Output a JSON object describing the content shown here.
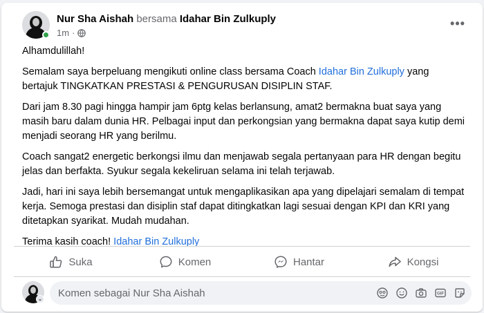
{
  "post": {
    "author": "Nur Sha Aishah",
    "with_text": "bersama",
    "tagged": "Idahar Bin Zulkuply",
    "time": "1m",
    "time_sep": "·",
    "privacy_icon": "globe-icon",
    "more_icon": "more-options-icon",
    "more_label": "•••"
  },
  "content": {
    "p1": "Alhamdulillah!",
    "p2_before": "Semalam saya berpeluang mengikuti online class bersama Coach ",
    "p2_link": "Idahar Bin Zulkuply",
    "p2_after": " yang bertajuk TINGKATKAN PRESTASI & PENGURUSAN DISIPLIN STAF.",
    "p3": "Dari jam 8.30 pagi hingga hampir jam 6ptg kelas berlansung, amat2 bermakna buat saya yang masih baru dalam dunia HR. Pelbagai input dan perkongsian yang bermakna dapat saya kutip demi menjadi seorang HR yang berilmu.",
    "p4": "Coach sangat2 energetic berkongsi ilmu dan menjawab segala pertanyaan para HR dengan begitu jelas dan berfakta. Syukur segala kekeliruan selama ini telah terjawab.",
    "p5": "Jadi, hari ini saya lebih bersemangat untuk mengaplikasikan apa yang dipelajari semalam di tempat kerja. Semoga prestasi dan disiplin staf dapat ditingkatkan lagi sesuai dengan KPI dan KRI yang ditetapkan syarikat. Mudah mudahan.",
    "p6_before": "Terima kasih coach! ",
    "p6_link": "Idahar Bin Zulkuply"
  },
  "actions": {
    "like": "Suka",
    "comment": "Komen",
    "send": "Hantar",
    "share": "Kongsi"
  },
  "comment_box": {
    "placeholder": "Komen sebagai Nur Sha Aishah",
    "chevron": "⌄",
    "icons": [
      "avatar-sticker-icon",
      "emoji-icon",
      "camera-icon",
      "gif-icon",
      "sticker-icon"
    ],
    "gif_label": "GIF"
  },
  "colors": {
    "link": "#216fdb",
    "online": "#31a24c",
    "muted": "#65676b"
  }
}
